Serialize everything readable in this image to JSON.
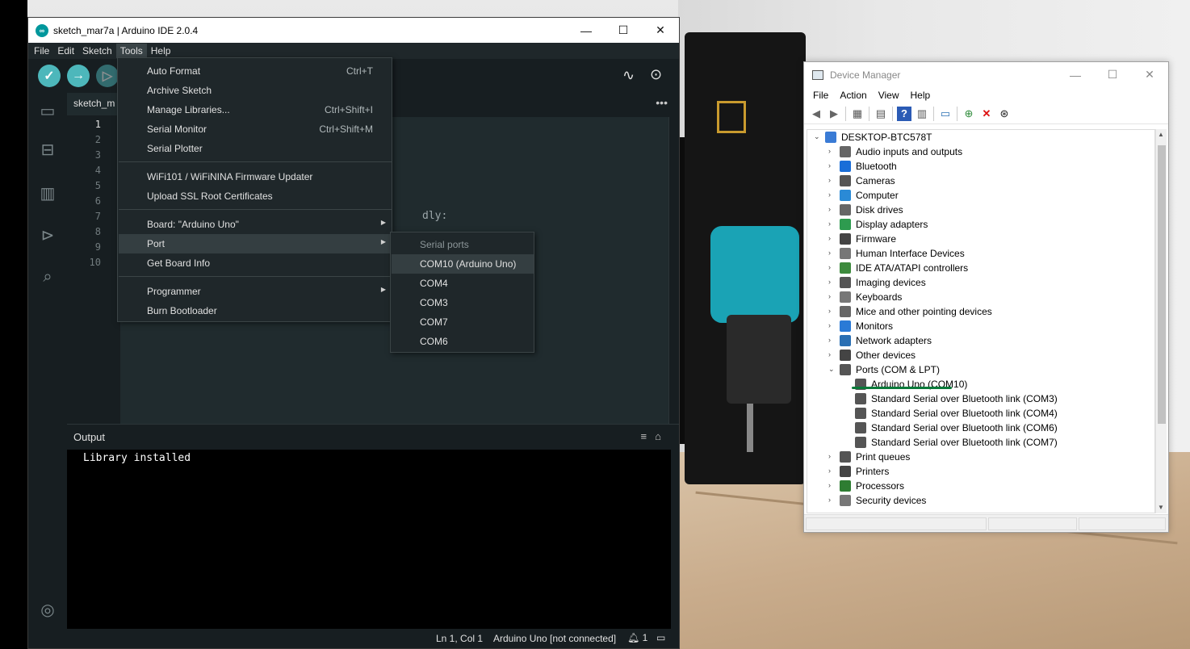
{
  "ide": {
    "window_title": "sketch_mar7a | Arduino IDE 2.0.4",
    "app_icon_glyph": "∞",
    "window_controls": {
      "minimize": "—",
      "maximize": "☐",
      "close": "✕"
    },
    "menu": [
      "File",
      "Edit",
      "Sketch",
      "Tools",
      "Help"
    ],
    "active_menu": "Tools",
    "tab_label": "sketch_m",
    "tab_more": "•••",
    "line_numbers": [
      "1",
      "2",
      "3",
      "4",
      "5",
      "6",
      "7",
      "8",
      "9",
      "10"
    ],
    "code_fragment": "dly:",
    "output_tab": "Output",
    "output_text": "Library installed",
    "status": {
      "position": "Ln 1, Col 1",
      "board": "Arduino Uno [not connected]",
      "notifications": "1"
    }
  },
  "tools_menu": {
    "items": [
      {
        "label": "Auto Format",
        "shortcut": "Ctrl+T"
      },
      {
        "label": "Archive Sketch",
        "shortcut": ""
      },
      {
        "label": "Manage Libraries...",
        "shortcut": "Ctrl+Shift+I"
      },
      {
        "label": "Serial Monitor",
        "shortcut": "Ctrl+Shift+M"
      },
      {
        "label": "Serial Plotter",
        "shortcut": ""
      },
      {
        "label": "WiFi101 / WiFiNINA Firmware Updater",
        "shortcut": ""
      },
      {
        "label": "Upload SSL Root Certificates",
        "shortcut": ""
      },
      {
        "label": "Board: \"Arduino Uno\"",
        "shortcut": ""
      },
      {
        "label": "Port",
        "shortcut": ""
      },
      {
        "label": "Get Board Info",
        "shortcut": ""
      },
      {
        "label": "Programmer",
        "shortcut": ""
      },
      {
        "label": "Burn Bootloader",
        "shortcut": ""
      }
    ],
    "highlighted": "Port"
  },
  "port_menu": {
    "header": "Serial ports",
    "items": [
      "COM10 (Arduino Uno)",
      "COM4",
      "COM3",
      "COM7",
      "COM6"
    ],
    "selected": "COM10 (Arduino Uno)"
  },
  "device_manager": {
    "window_title": "Device Manager",
    "menu": [
      "File",
      "Action",
      "View",
      "Help"
    ],
    "root": "DESKTOP-BTC578T",
    "categories": [
      "Audio inputs and outputs",
      "Bluetooth",
      "Cameras",
      "Computer",
      "Disk drives",
      "Display adapters",
      "Firmware",
      "Human Interface Devices",
      "IDE ATA/ATAPI controllers",
      "Imaging devices",
      "Keyboards",
      "Mice and other pointing devices",
      "Monitors",
      "Network adapters",
      "Other devices",
      "Ports (COM & LPT)"
    ],
    "ports_children": [
      "Arduino Uno (COM10)",
      "Standard Serial over Bluetooth link (COM3)",
      "Standard Serial over Bluetooth link (COM4)",
      "Standard Serial over Bluetooth link (COM6)",
      "Standard Serial over Bluetooth link (COM7)"
    ],
    "categories_after": [
      "Print queues",
      "Printers",
      "Processors",
      "Security devices"
    ]
  }
}
